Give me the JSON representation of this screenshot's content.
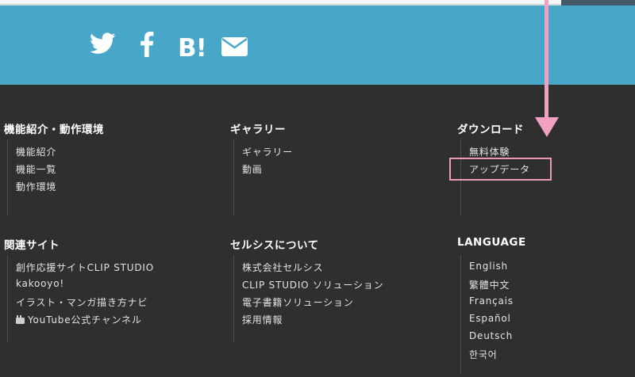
{
  "social": {
    "icons": [
      "twitter-icon",
      "facebook-icon",
      "hatena-bookmark-icon",
      "mail-icon"
    ],
    "hatena_label": "B!"
  },
  "columns": [
    {
      "title": "機能紹介・動作環境",
      "items": [
        "機能紹介",
        "機能一覧",
        "動作環境"
      ]
    },
    {
      "title": "ギャラリー",
      "items": [
        "ギャラリー",
        "動画"
      ]
    },
    {
      "title": "ダウンロード",
      "items": [
        "無料体験",
        "アップデータ"
      ]
    },
    {
      "title": "関連サイト",
      "items": [
        "創作応援サイトCLIP STUDIO",
        "kakooyo!",
        "イラスト・マンガ描き方ナビ",
        "YouTube公式チャンネル"
      ]
    },
    {
      "title": "セルシスについて",
      "items": [
        "株式会社セルシス",
        "CLIP STUDIO ソリューション",
        "電子書籍ソリューション",
        "採用情報"
      ]
    },
    {
      "title": "LANGUAGE",
      "items": [
        "English",
        "繁體中文",
        "Français",
        "Español",
        "Deutsch",
        "한국어"
      ]
    }
  ],
  "annotation": {
    "color": "#f0a0c0",
    "highlighted_item": "アップデータ"
  },
  "colors": {
    "social_bar": "#48a6c8",
    "footer_bg": "#2f2f30",
    "text": "#e3e3e3"
  }
}
